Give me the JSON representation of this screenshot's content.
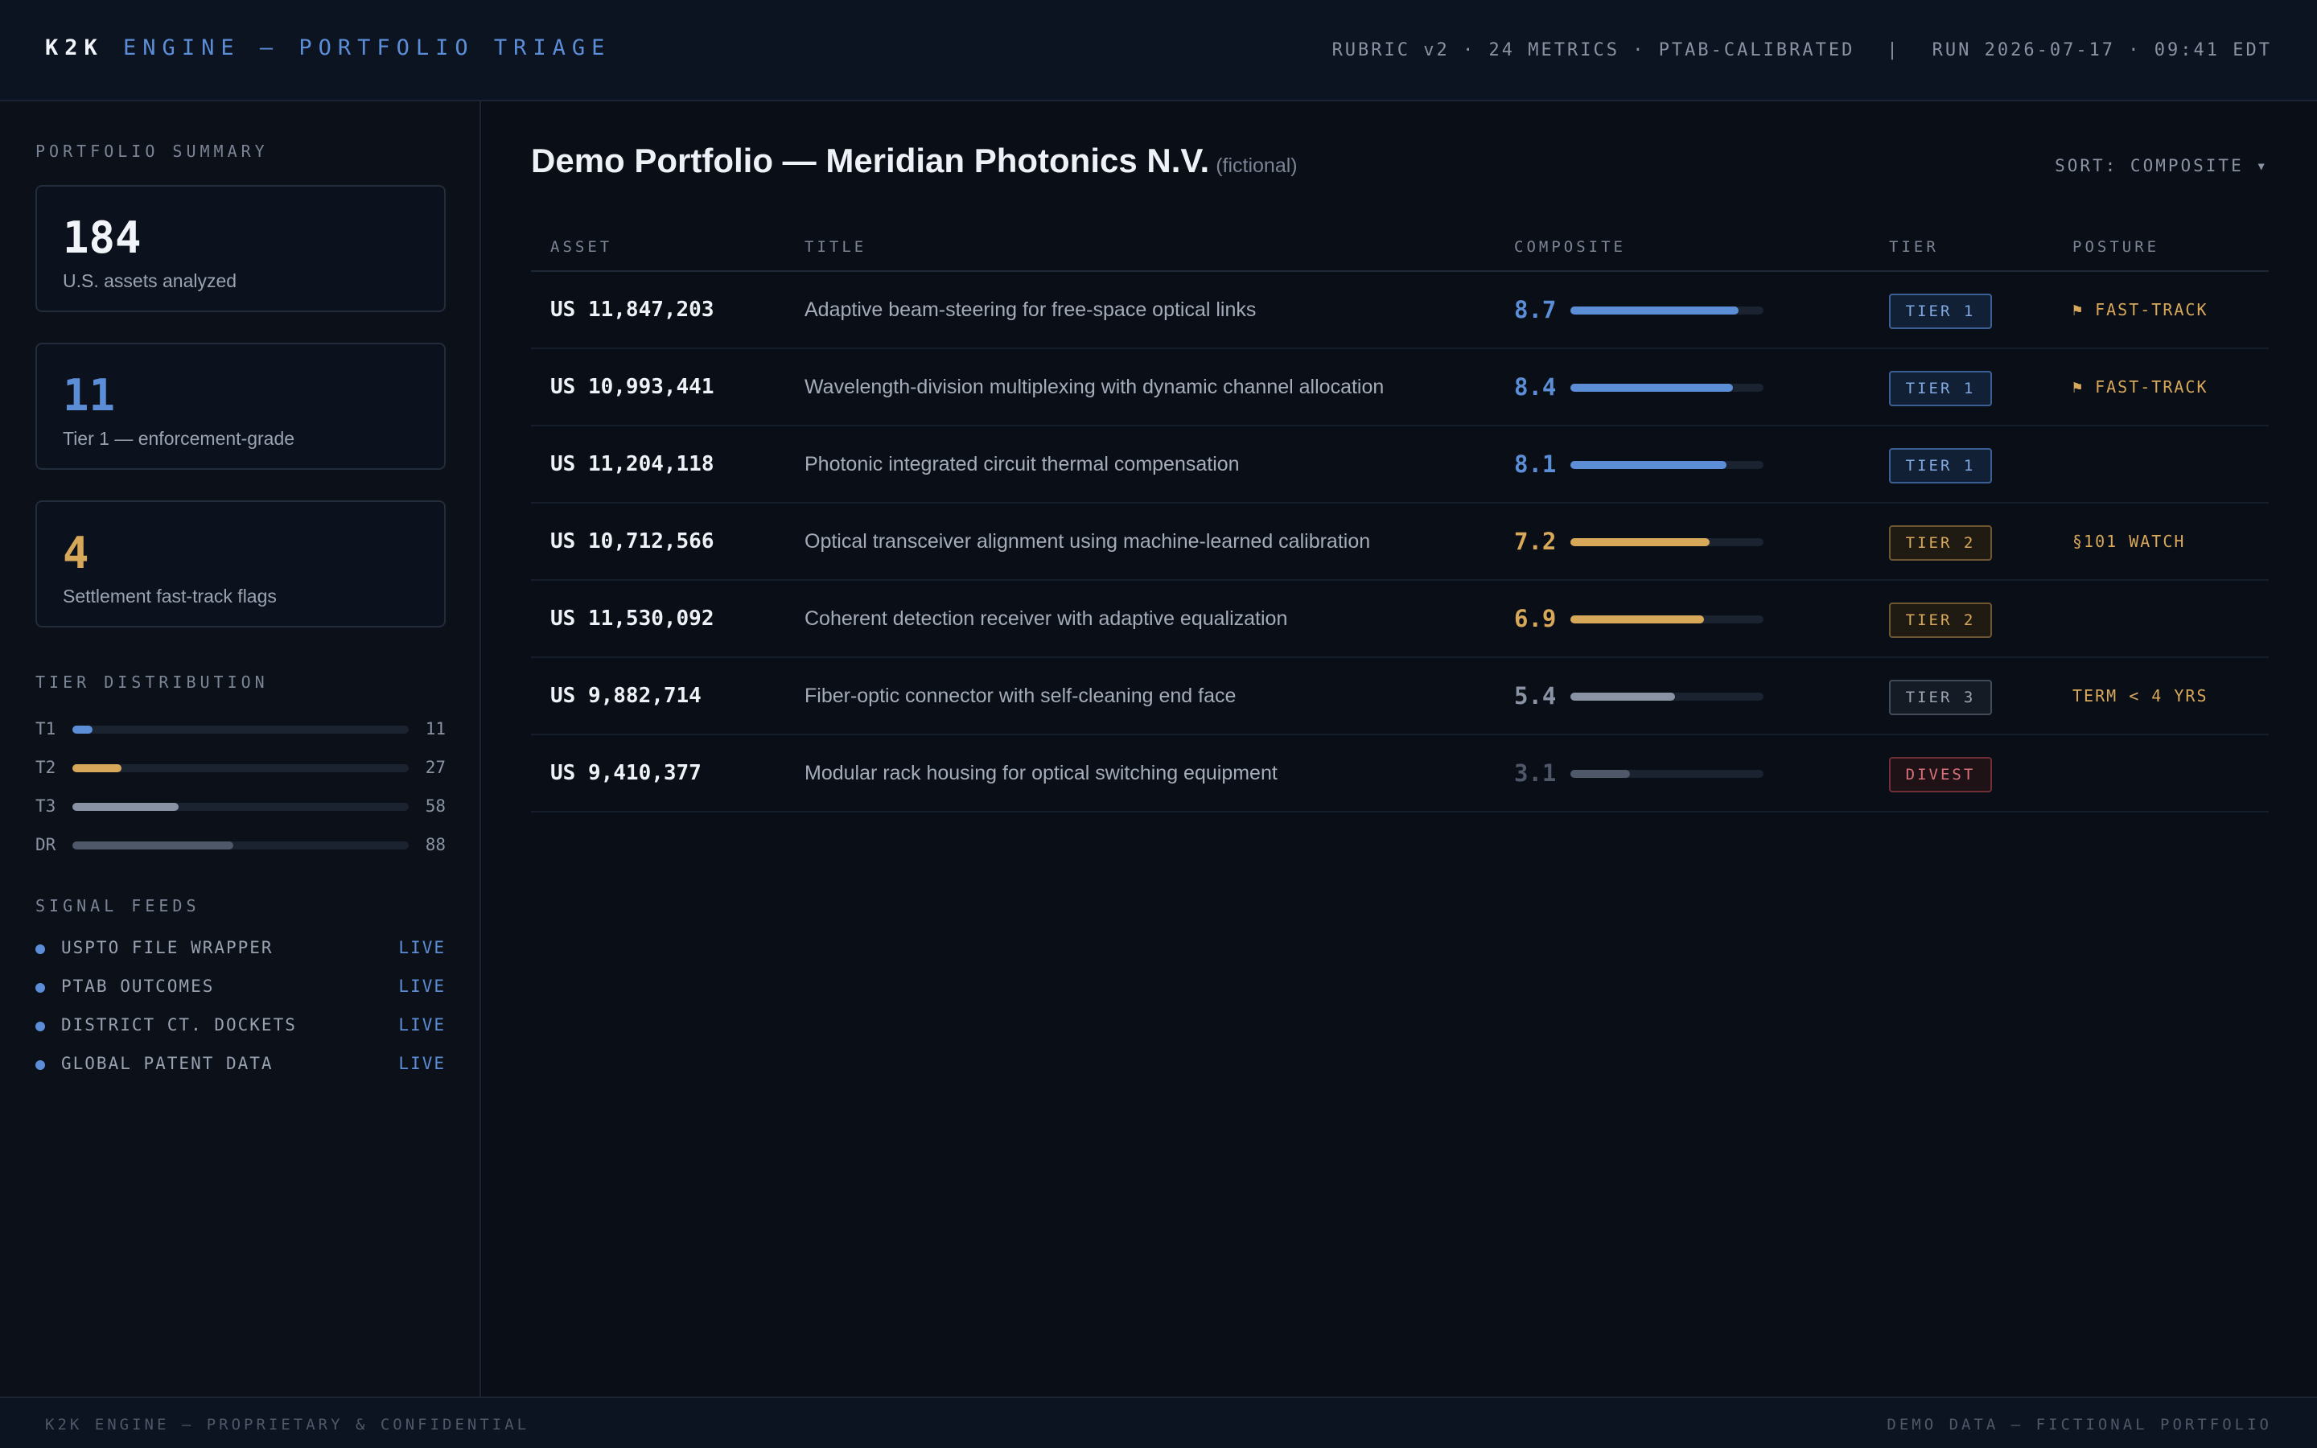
{
  "header": {
    "brand_short": "K2K",
    "brand_title": "ENGINE — PORTFOLIO TRIAGE",
    "rubric": "RUBRIC v2 · 24 METRICS · PTAB-CALIBRATED",
    "separator": "|",
    "run": "RUN 2026-07-17 · 09:41 EDT"
  },
  "sidebar": {
    "summary_label": "PORTFOLIO SUMMARY",
    "cards": [
      {
        "value": "184",
        "desc": "U.S. assets analyzed",
        "color": "#f1f4f9"
      },
      {
        "value": "11",
        "desc": "Tier 1 — enforcement-grade",
        "color": "#5b8ed6"
      },
      {
        "value": "4",
        "desc": "Settlement fast-track flags",
        "color": "#d8a85a"
      }
    ],
    "distribution_label": "TIER DISTRIBUTION",
    "distribution": [
      {
        "label": "T1",
        "count": 11,
        "color": "#5b8ed6"
      },
      {
        "label": "T2",
        "count": 27,
        "color": "#d8a85a"
      },
      {
        "label": "T3",
        "count": 58,
        "color": "#8a93a3"
      },
      {
        "label": "DR",
        "count": 88,
        "color": "#4f5868"
      }
    ],
    "feeds_label": "SIGNAL FEEDS",
    "feeds": [
      {
        "name": "USPTO FILE WRAPPER",
        "status": "LIVE"
      },
      {
        "name": "PTAB OUTCOMES",
        "status": "LIVE"
      },
      {
        "name": "DISTRICT CT. DOCKETS",
        "status": "LIVE"
      },
      {
        "name": "GLOBAL PATENT DATA",
        "status": "LIVE"
      }
    ]
  },
  "main": {
    "title": "Demo Portfolio — Meridian Photonics N.V.",
    "title_note": "(fictional)",
    "sort": "SORT: COMPOSITE ▾",
    "columns": [
      "ASSET",
      "TITLE",
      "COMPOSITE",
      "TIER",
      "POSTURE"
    ],
    "score_max": 10,
    "rows": [
      {
        "asset": "US 11,847,203",
        "title": "Adaptive beam-steering for free-space optical links",
        "score": "8.7",
        "tier": "TIER 1",
        "tier_kind": "t1",
        "posture": "⚑ FAST-TRACK"
      },
      {
        "asset": "US 10,993,441",
        "title": "Wavelength-division multiplexing with dynamic channel allocation",
        "score": "8.4",
        "tier": "TIER 1",
        "tier_kind": "t1",
        "posture": "⚑ FAST-TRACK"
      },
      {
        "asset": "US 11,204,118",
        "title": "Photonic integrated circuit thermal compensation",
        "score": "8.1",
        "tier": "TIER 1",
        "tier_kind": "t1",
        "posture": ""
      },
      {
        "asset": "US 10,712,566",
        "title": "Optical transceiver alignment using machine-learned calibration",
        "score": "7.2",
        "tier": "TIER 2",
        "tier_kind": "t2",
        "posture": "§101 WATCH"
      },
      {
        "asset": "US 11,530,092",
        "title": "Coherent detection receiver with adaptive equalization",
        "score": "6.9",
        "tier": "TIER 2",
        "tier_kind": "t2",
        "posture": ""
      },
      {
        "asset": "US 9,882,714",
        "title": "Fiber-optic connector with self-cleaning end face",
        "score": "5.4",
        "tier": "TIER 3",
        "tier_kind": "t3",
        "posture": "TERM < 4 YRS"
      },
      {
        "asset": "US 9,410,377",
        "title": "Modular rack housing for optical switching equipment",
        "score": "3.1",
        "tier": "DIVEST",
        "tier_kind": "dv",
        "posture": ""
      }
    ]
  },
  "tier_styles": {
    "t1": {
      "text": "#7fa7e0",
      "border": "#3a5f94",
      "bg": "#122036",
      "bar": "#5b8ed6"
    },
    "t2": {
      "text": "#d8a85a",
      "border": "#6e5631",
      "bg": "#1f1a12",
      "bar": "#d8a85a"
    },
    "t3": {
      "text": "#9aa3b2",
      "border": "#424b5a",
      "bg": "#151b25",
      "bar": "#8a93a3"
    },
    "dv": {
      "text": "#d9717a",
      "border": "#6e2f36",
      "bg": "#1f1217",
      "bar": "#4f5868"
    }
  },
  "footer": {
    "left": "K2K ENGINE — PROPRIETARY & CONFIDENTIAL",
    "right": "DEMO DATA — FICTIONAL PORTFOLIO"
  }
}
